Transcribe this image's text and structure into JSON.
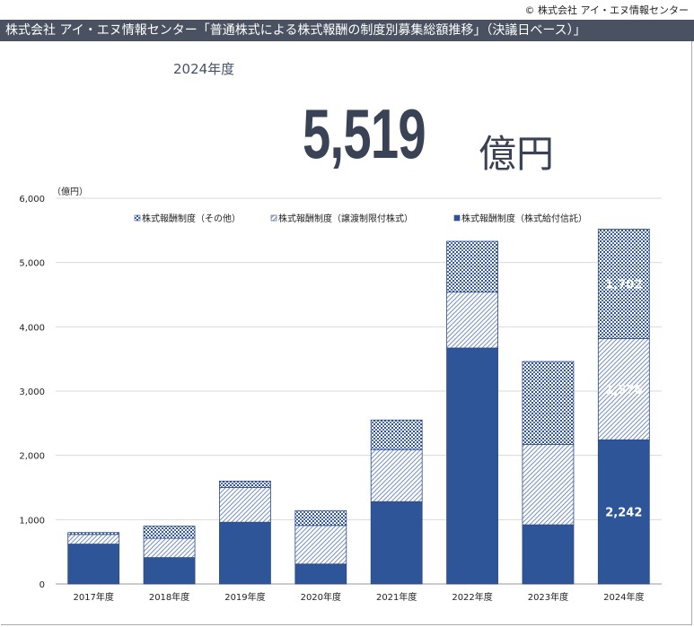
{
  "header": {
    "copyright": "© 株式会社 アイ・エヌ情報センター",
    "title": "株式会社 アイ・エヌ情報センター「普通株式による株式報酬の制度別募集総額推移」（決議日ベース）」"
  },
  "highlight": {
    "year": "2024年度",
    "value": "5,519",
    "unit": "億円"
  },
  "colors": {
    "trust": "#2e5597",
    "restricted_fg": "#3a5f9e",
    "other_fg": "#2e5597"
  },
  "chart_data": {
    "type": "bar",
    "stacked": true,
    "unit_label": "（億円）",
    "categories": [
      "2017年度",
      "2018年度",
      "2019年度",
      "2020年度",
      "2021年度",
      "2022年度",
      "2023年度",
      "2024年度"
    ],
    "series": [
      {
        "name": "株式報酬制度（株式給付信託）",
        "values": [
          620,
          410,
          960,
          310,
          1280,
          3670,
          920,
          2242
        ]
      },
      {
        "name": "株式報酬制度（譲渡制限付株式）",
        "values": [
          150,
          300,
          540,
          600,
          810,
          870,
          1250,
          1576
        ]
      },
      {
        "name": "株式報酬制度（その他）",
        "values": [
          30,
          190,
          100,
          230,
          460,
          790,
          1290,
          1702
        ]
      }
    ],
    "data_labels": {
      "2024年度": [
        "2,242",
        "1,576",
        "1,702"
      ]
    },
    "ylim": [
      0,
      6000
    ],
    "yticks": [
      "0",
      "1,000",
      "2,000",
      "3,000",
      "4,000",
      "5,000",
      "6,000"
    ],
    "grid": true,
    "legend": "top"
  }
}
